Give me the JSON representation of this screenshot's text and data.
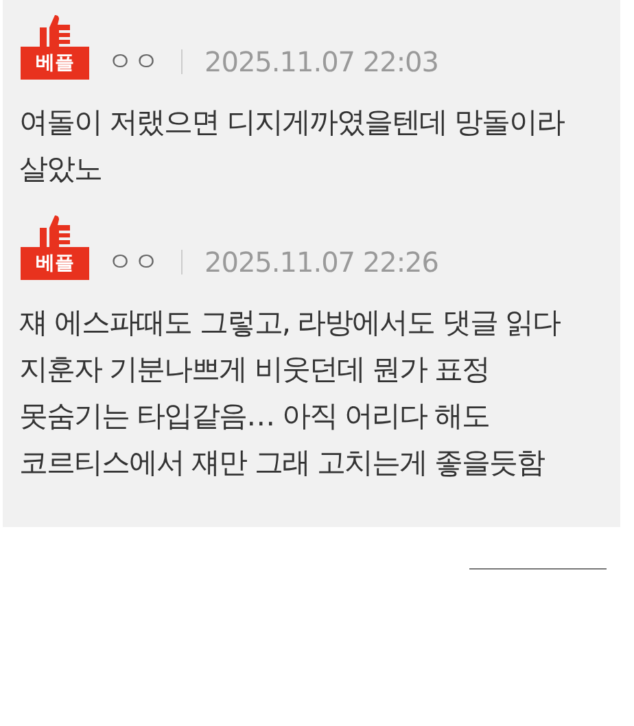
{
  "comments": [
    {
      "badge": "베플",
      "author": "ㅇㅇ",
      "date": "2025.11.07 22:03",
      "body": "여돌이 저랬으면 디지게까였을텐데 망돌이라 살았노"
    },
    {
      "badge": "베플",
      "author": "ㅇㅇ",
      "date": "2025.11.07 22:26",
      "body": "쟤 에스파때도 그렇고, 라방에서도 댓글 읽다 지훈자 기분나쁘게 비웃던데 뭔가 표정 못숨기는 타입같음… 아직 어리다 해도 코르티스에서 쟤만 그래 고치는게 좋을듯함"
    }
  ]
}
